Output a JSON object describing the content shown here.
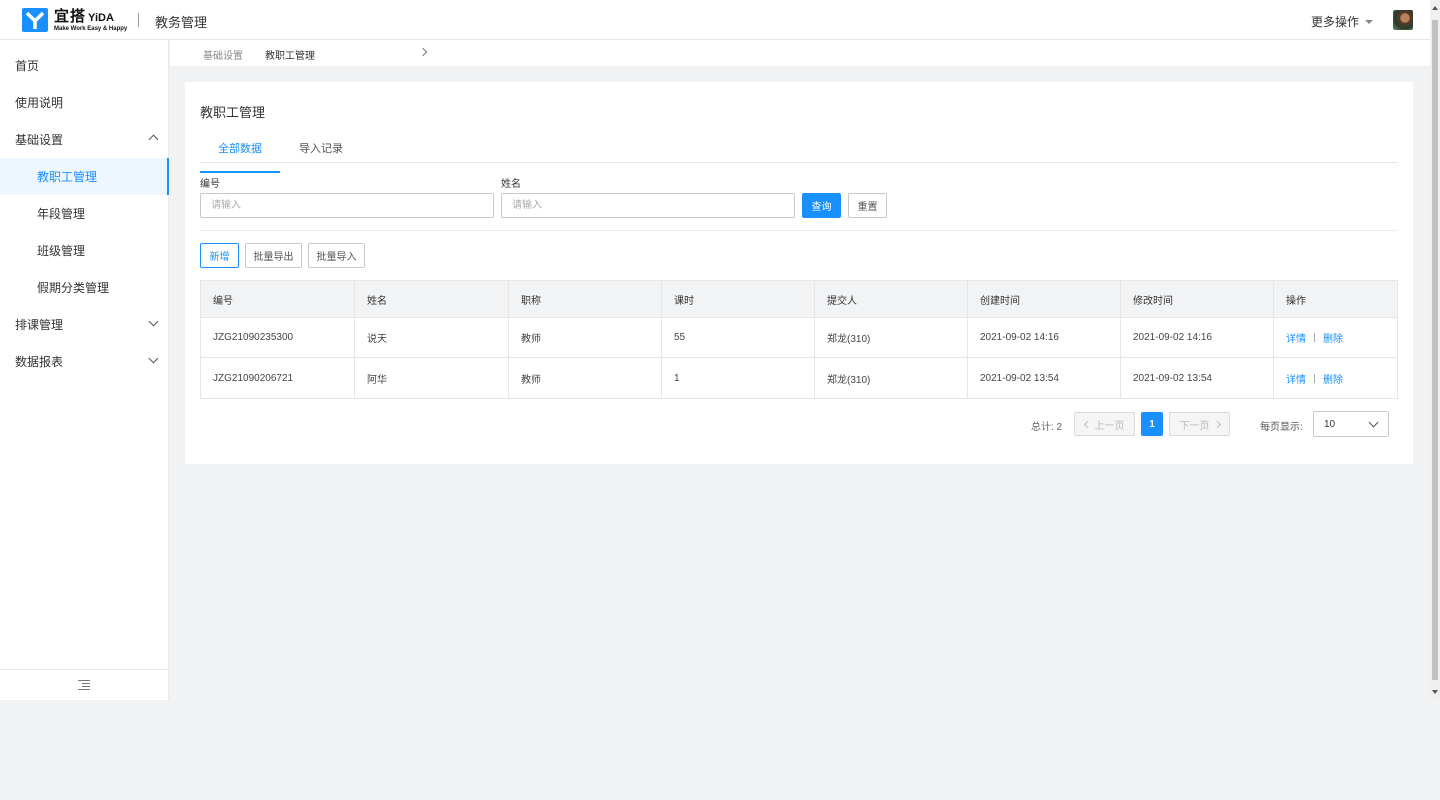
{
  "header": {
    "logo_title": "宜搭",
    "logo_title_en": "YiDA",
    "logo_slogan": "Make Work Easy & Happy",
    "app_title": "教务管理",
    "more_actions": "更多操作"
  },
  "sidebar": {
    "items": [
      {
        "label": "首页"
      },
      {
        "label": "使用说明"
      },
      {
        "label": "基础设置"
      },
      {
        "label": "教职工管理"
      },
      {
        "label": "年段管理"
      },
      {
        "label": "班级管理"
      },
      {
        "label": "假期分类管理"
      },
      {
        "label": "排课管理"
      },
      {
        "label": "数据报表"
      }
    ]
  },
  "breadcrumb": [
    "基础设置",
    "教职工管理"
  ],
  "main": {
    "title": "教职工管理",
    "tabs": [
      {
        "label": "全部数据"
      },
      {
        "label": "导入记录"
      }
    ],
    "filters": {
      "id_label": "编号",
      "id_placeholder": "请输入",
      "name_label": "姓名",
      "name_placeholder": "请输入",
      "search": "查询",
      "reset": "重置"
    },
    "actions": {
      "add": "新增",
      "export": "批量导出",
      "import": "批量导入"
    },
    "table": {
      "columns": [
        "编号",
        "姓名",
        "职称",
        "课时",
        "提交人",
        "创建时间",
        "修改时间",
        "操作"
      ],
      "rows": [
        [
          "JZG21090235300",
          "说天",
          "教师",
          "55",
          "郑龙(310)",
          "2021-09-02 14:16",
          "2021-09-02 14:16"
        ],
        [
          "JZG21090206721",
          "阿华",
          "教师",
          "1",
          "郑龙(310)",
          "2021-09-02 13:54",
          "2021-09-02 13:54"
        ]
      ],
      "row_ops": {
        "detail": "详情",
        "delete": "删除"
      }
    },
    "pagination": {
      "total": "总计: 2",
      "prev": "上一页",
      "current": "1",
      "next": "下一页",
      "per_page_label": "每页显示:",
      "per_page": "10"
    }
  },
  "colors": {
    "primary": "#1890ff",
    "background": "#f1f2f4"
  }
}
